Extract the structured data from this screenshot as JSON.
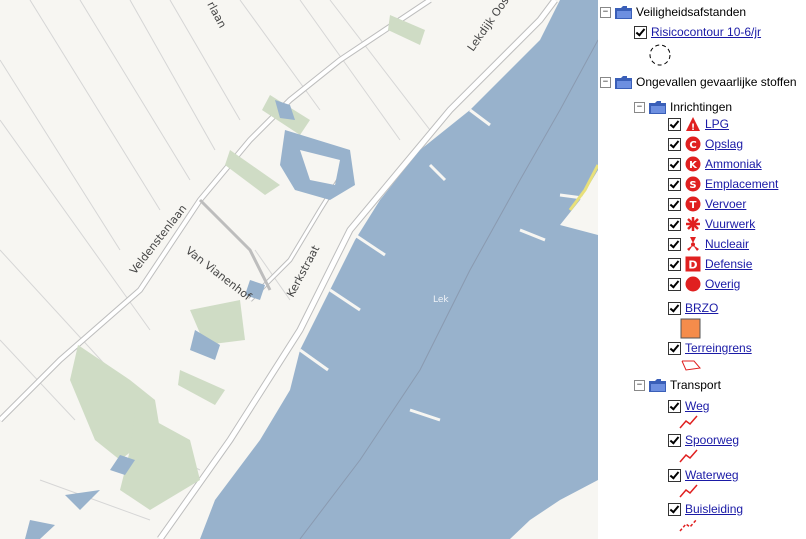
{
  "map": {
    "labels": {
      "street_1": "Veldenstenlaan",
      "street_2": "Van Vianenhof",
      "street_3": "Kerkstraat",
      "street_4": "Lekdijk Oost",
      "street_5": "rlaan",
      "river": "Lek"
    },
    "colors": {
      "water": "#98b2cc",
      "green": "#cfdcc5",
      "land": "#f7f6f2",
      "road_line": "#c8c8c8"
    }
  },
  "legend": {
    "groups": [
      {
        "label": "Veiligheidsafstanden",
        "items": [
          {
            "label": "Risicocontour 10-6/jr",
            "symbol": "dashed-circle"
          }
        ]
      },
      {
        "label": "Ongevallen gevaarlijke stoffen",
        "subgroups": [
          {
            "label": "Inrichtingen",
            "items": [
              {
                "label": "LPG",
                "icon": "warning-triangle-icon"
              },
              {
                "label": "Opslag",
                "icon": "C"
              },
              {
                "label": "Ammoniak",
                "icon": "K"
              },
              {
                "label": "Emplacement",
                "icon": "S"
              },
              {
                "label": "Vervoer",
                "icon": "T"
              },
              {
                "label": "Vuurwerk",
                "icon": "firework-icon"
              },
              {
                "label": "Nucleair",
                "icon": "radiation-icon"
              },
              {
                "label": "Defensie",
                "icon": "D"
              },
              {
                "label": "Overig",
                "icon": "red-circle-icon"
              },
              {
                "label": "BRZO",
                "symbol": "orange-square"
              },
              {
                "label": "Terreingrens",
                "symbol": "red-outline"
              }
            ]
          },
          {
            "label": "Transport",
            "items": [
              {
                "label": "Weg",
                "symbol": "red-line"
              },
              {
                "label": "Spoorweg",
                "symbol": "red-line"
              },
              {
                "label": "Waterweg",
                "symbol": "red-line"
              },
              {
                "label": "Buisleiding",
                "symbol": "red-dashed-line"
              }
            ]
          }
        ]
      }
    ],
    "icon_color": "#e02020"
  }
}
